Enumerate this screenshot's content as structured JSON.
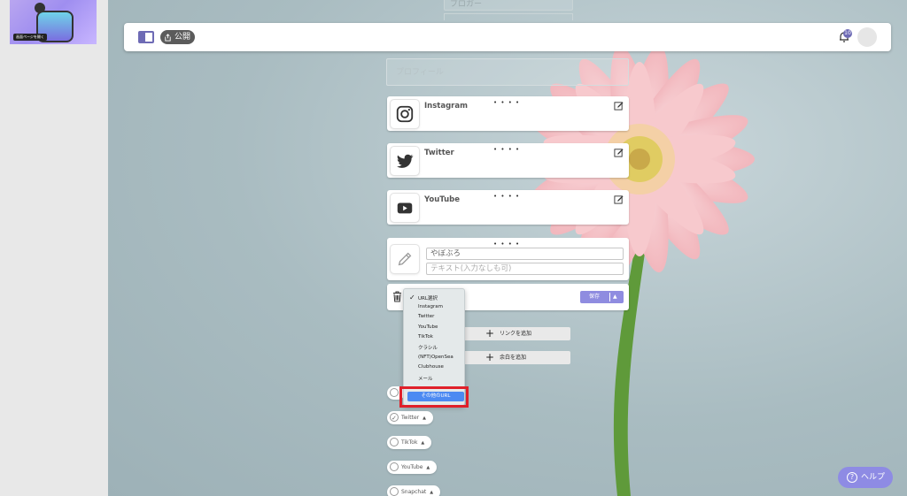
{
  "sidebar": {
    "thumbnail_badge": "画面ページを開く"
  },
  "topbar": {
    "publish_label": "公開",
    "notification_count": "10"
  },
  "fields": {
    "occupation_placeholder": "ブロガー",
    "profile_placeholder": "プロフィール"
  },
  "links": [
    {
      "name": "Instagram",
      "dots": "• • • •",
      "icon": "instagram-icon"
    },
    {
      "name": "Twitter",
      "dots": "• • • •",
      "icon": "twitter-icon"
    },
    {
      "name": "YouTube",
      "dots": "• • • •",
      "icon": "youtube-icon"
    }
  ],
  "custom_link": {
    "dots": "• • • •",
    "title_value": "やぼぶろ",
    "text_placeholder": "テキスト(入力なしも可)"
  },
  "url_row": {
    "save_label": "保存"
  },
  "dropdown": {
    "options": [
      "URL選択",
      "Instagram",
      "Twitter",
      "YouTube",
      "TikTok",
      "クラシル",
      "(NFT)OpenSea",
      "Clubhouse",
      "メール"
    ],
    "selected": "その他のURL"
  },
  "add_buttons": {
    "link": "リンクを追加",
    "space": "余白を追加"
  },
  "sns_pills": [
    {
      "label": "",
      "checked": false
    },
    {
      "label": "Twitter",
      "checked": true
    },
    {
      "label": "TikTok",
      "checked": false
    },
    {
      "label": "YouTube",
      "checked": false
    },
    {
      "label": "Snapchat",
      "checked": false
    }
  ],
  "help": {
    "label": "ヘルプ"
  },
  "colors": {
    "accent": "#8e8be4",
    "highlight": "#e0202a",
    "selected_option": "#4c8af2"
  }
}
